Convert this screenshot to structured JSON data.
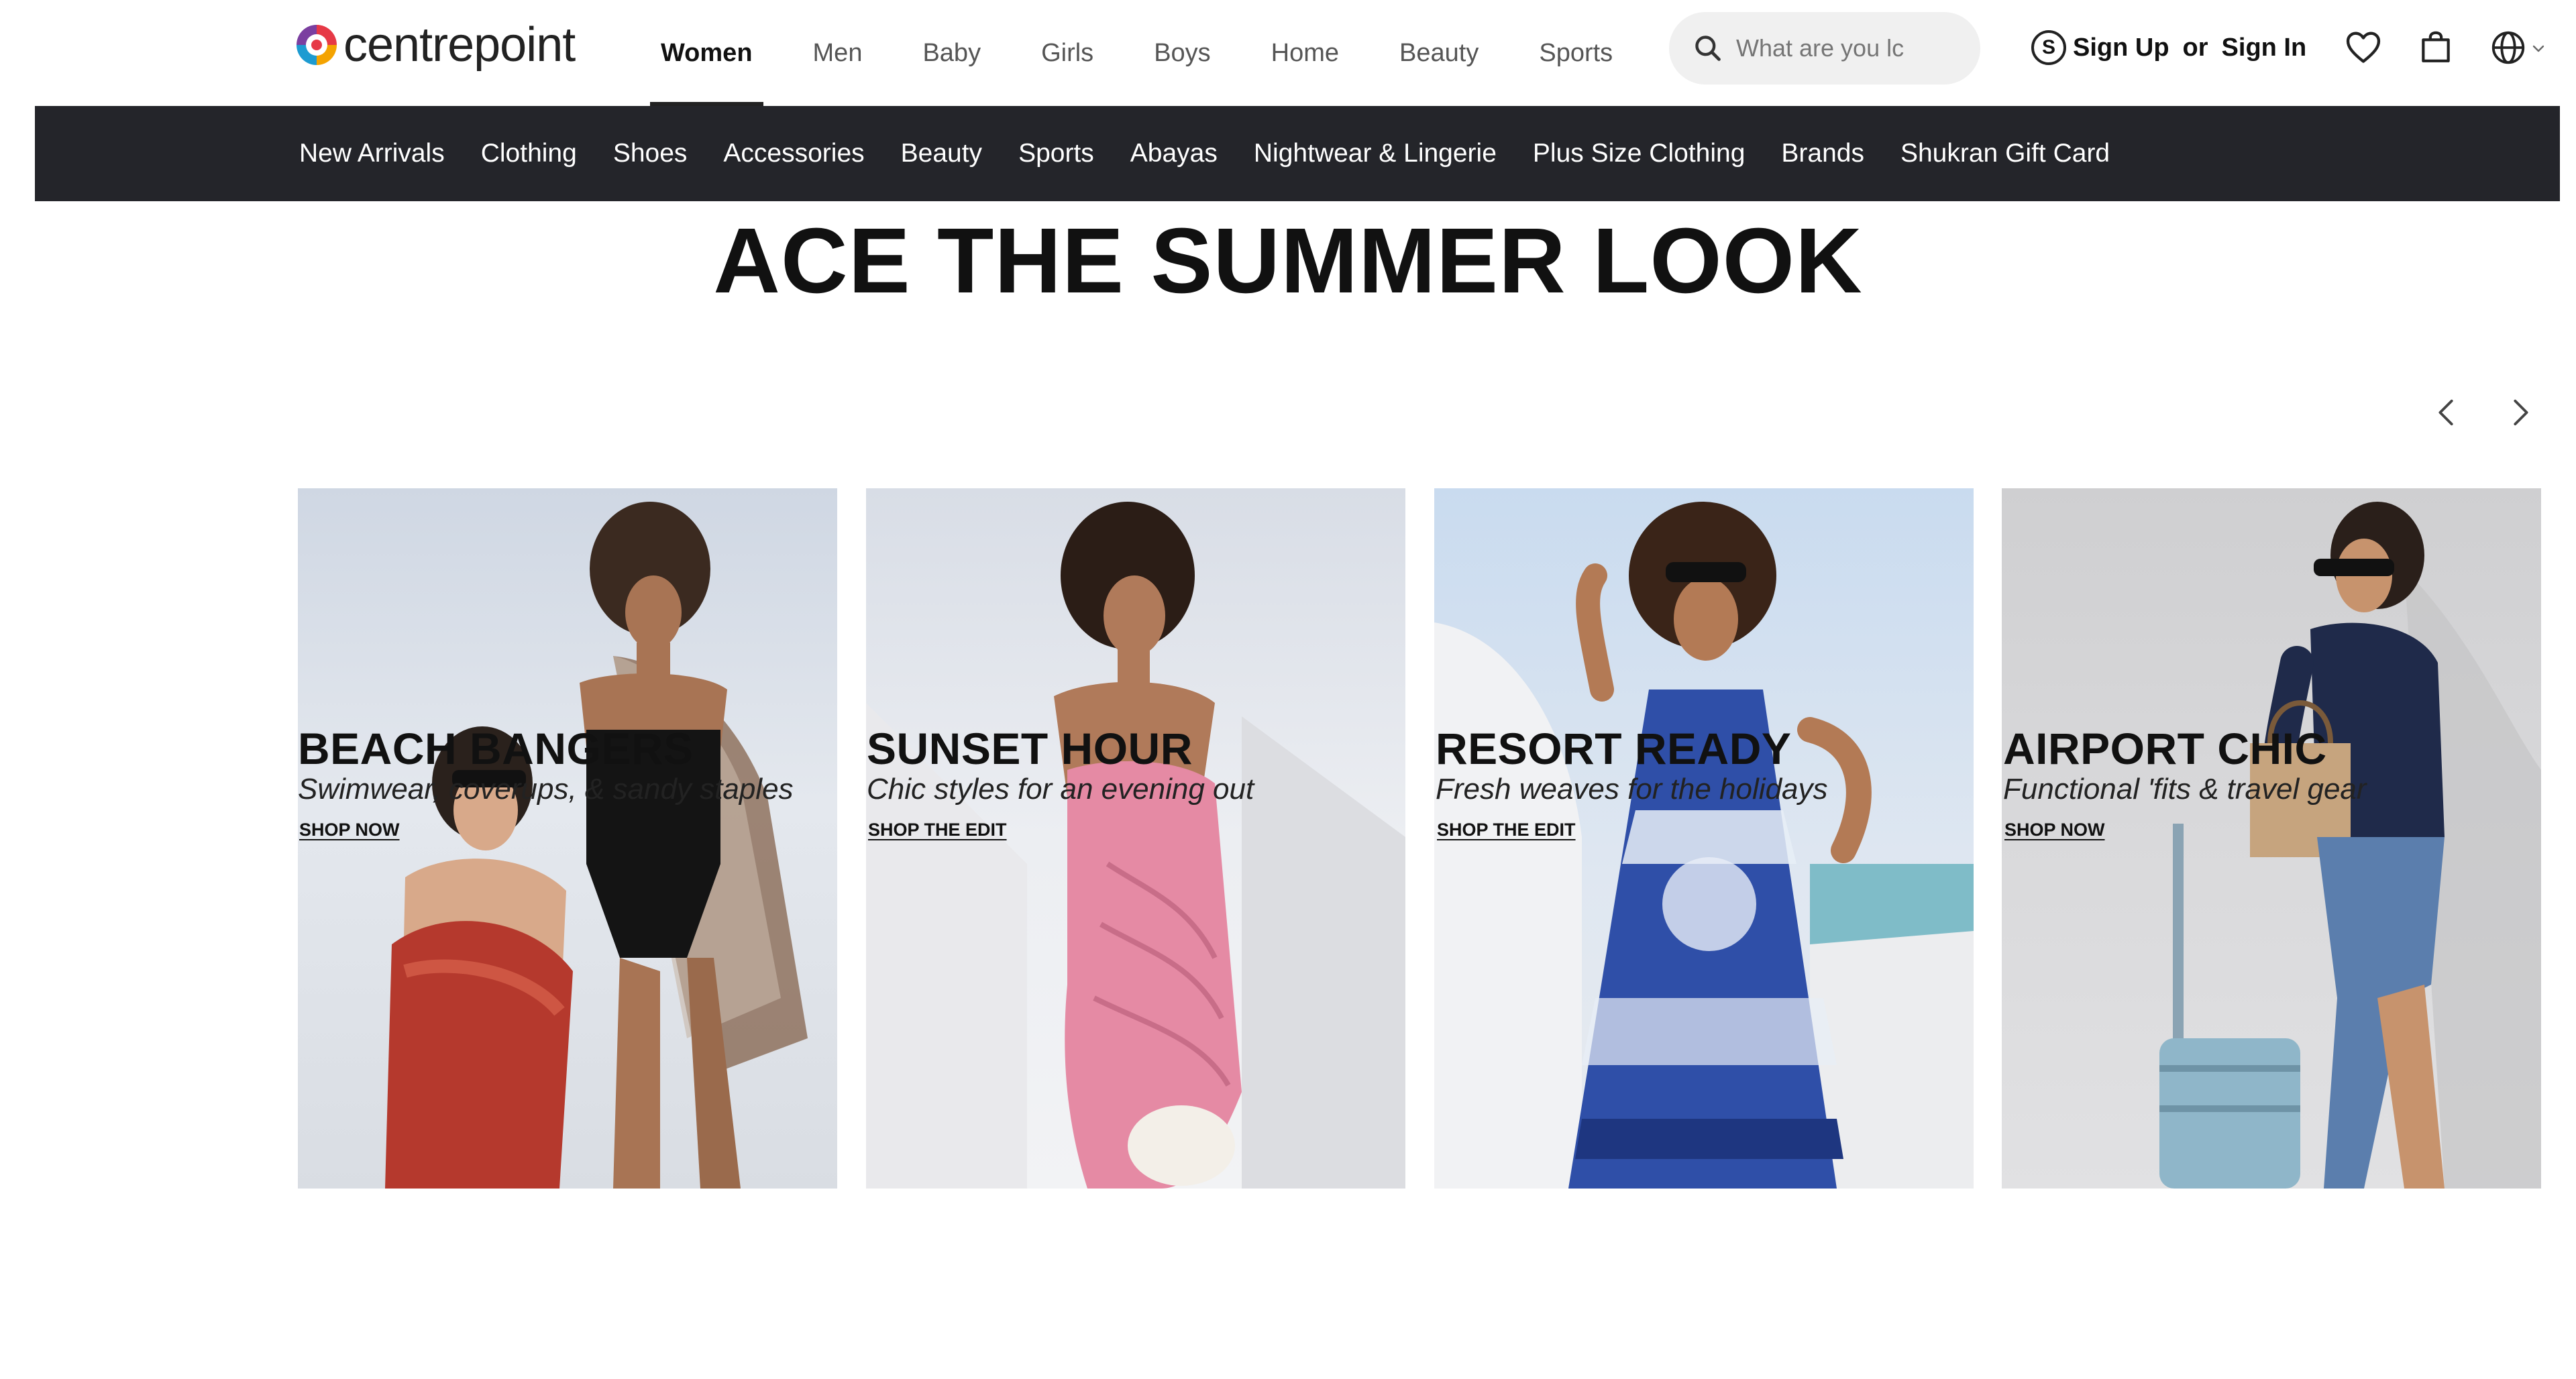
{
  "header": {
    "logo_text": "centrepoint",
    "nav": [
      "Women",
      "Men",
      "Baby",
      "Girls",
      "Boys",
      "Home",
      "Beauty",
      "Sports"
    ],
    "active_nav": "Women",
    "search_placeholder": "What are you lc",
    "auth": {
      "sign_up": "Sign Up",
      "or": "or",
      "sign_in": "Sign In",
      "points_icon": "shukran-s-icon"
    },
    "icons": [
      "heart-icon",
      "bag-icon",
      "globe-icon",
      "chevron-down-icon"
    ]
  },
  "categories": [
    "New Arrivals",
    "Clothing",
    "Shoes",
    "Accessories",
    "Beauty",
    "Sports",
    "Abayas",
    "Nightwear & Lingerie",
    "Plus Size Clothing",
    "Brands",
    "Shukran Gift Card"
  ],
  "headline": "ACE THE SUMMER LOOK",
  "cards": [
    {
      "title": "BEACH BANGERS",
      "subtitle": "Swimwear, coverups, & sandy staples",
      "cta": "SHOP NOW"
    },
    {
      "title": "SUNSET HOUR",
      "subtitle": "Chic styles for an evening out",
      "cta": "SHOP THE EDIT"
    },
    {
      "title": "RESORT READY",
      "subtitle": "Fresh weaves for the holidays",
      "cta": "SHOP THE EDIT"
    },
    {
      "title": "AIRPORT CHIC",
      "subtitle": "Functional 'fits & travel gear",
      "cta": "SHOP NOW"
    }
  ],
  "colors": {
    "category_bar": "#24252a",
    "search_bg": "#f0f0f0",
    "text": "#111111"
  }
}
